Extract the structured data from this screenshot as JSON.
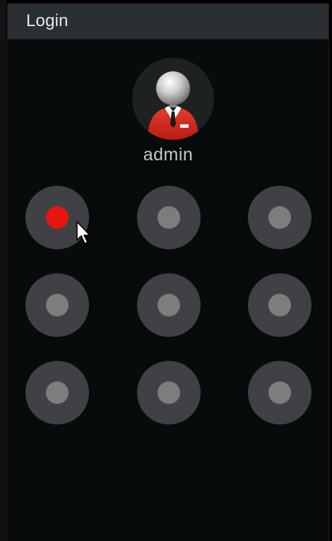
{
  "window": {
    "title": "Login"
  },
  "user": {
    "name": "admin",
    "avatar_icon": "user-avatar-icon"
  },
  "pattern": {
    "nodes": [
      {
        "id": 1,
        "state": "active"
      },
      {
        "id": 2,
        "state": "inactive"
      },
      {
        "id": 3,
        "state": "inactive"
      },
      {
        "id": 4,
        "state": "inactive"
      },
      {
        "id": 5,
        "state": "inactive"
      },
      {
        "id": 6,
        "state": "inactive"
      },
      {
        "id": 7,
        "state": "inactive"
      },
      {
        "id": 8,
        "state": "inactive"
      },
      {
        "id": 9,
        "state": "inactive"
      }
    ]
  },
  "colors": {
    "background": "#070B0B",
    "titlebar": "#2B2E33",
    "node_ring": "#3F4145",
    "node_dot": "#7E7C7D",
    "node_active": "#E8150E",
    "avatar_suit": "#D6281F"
  }
}
